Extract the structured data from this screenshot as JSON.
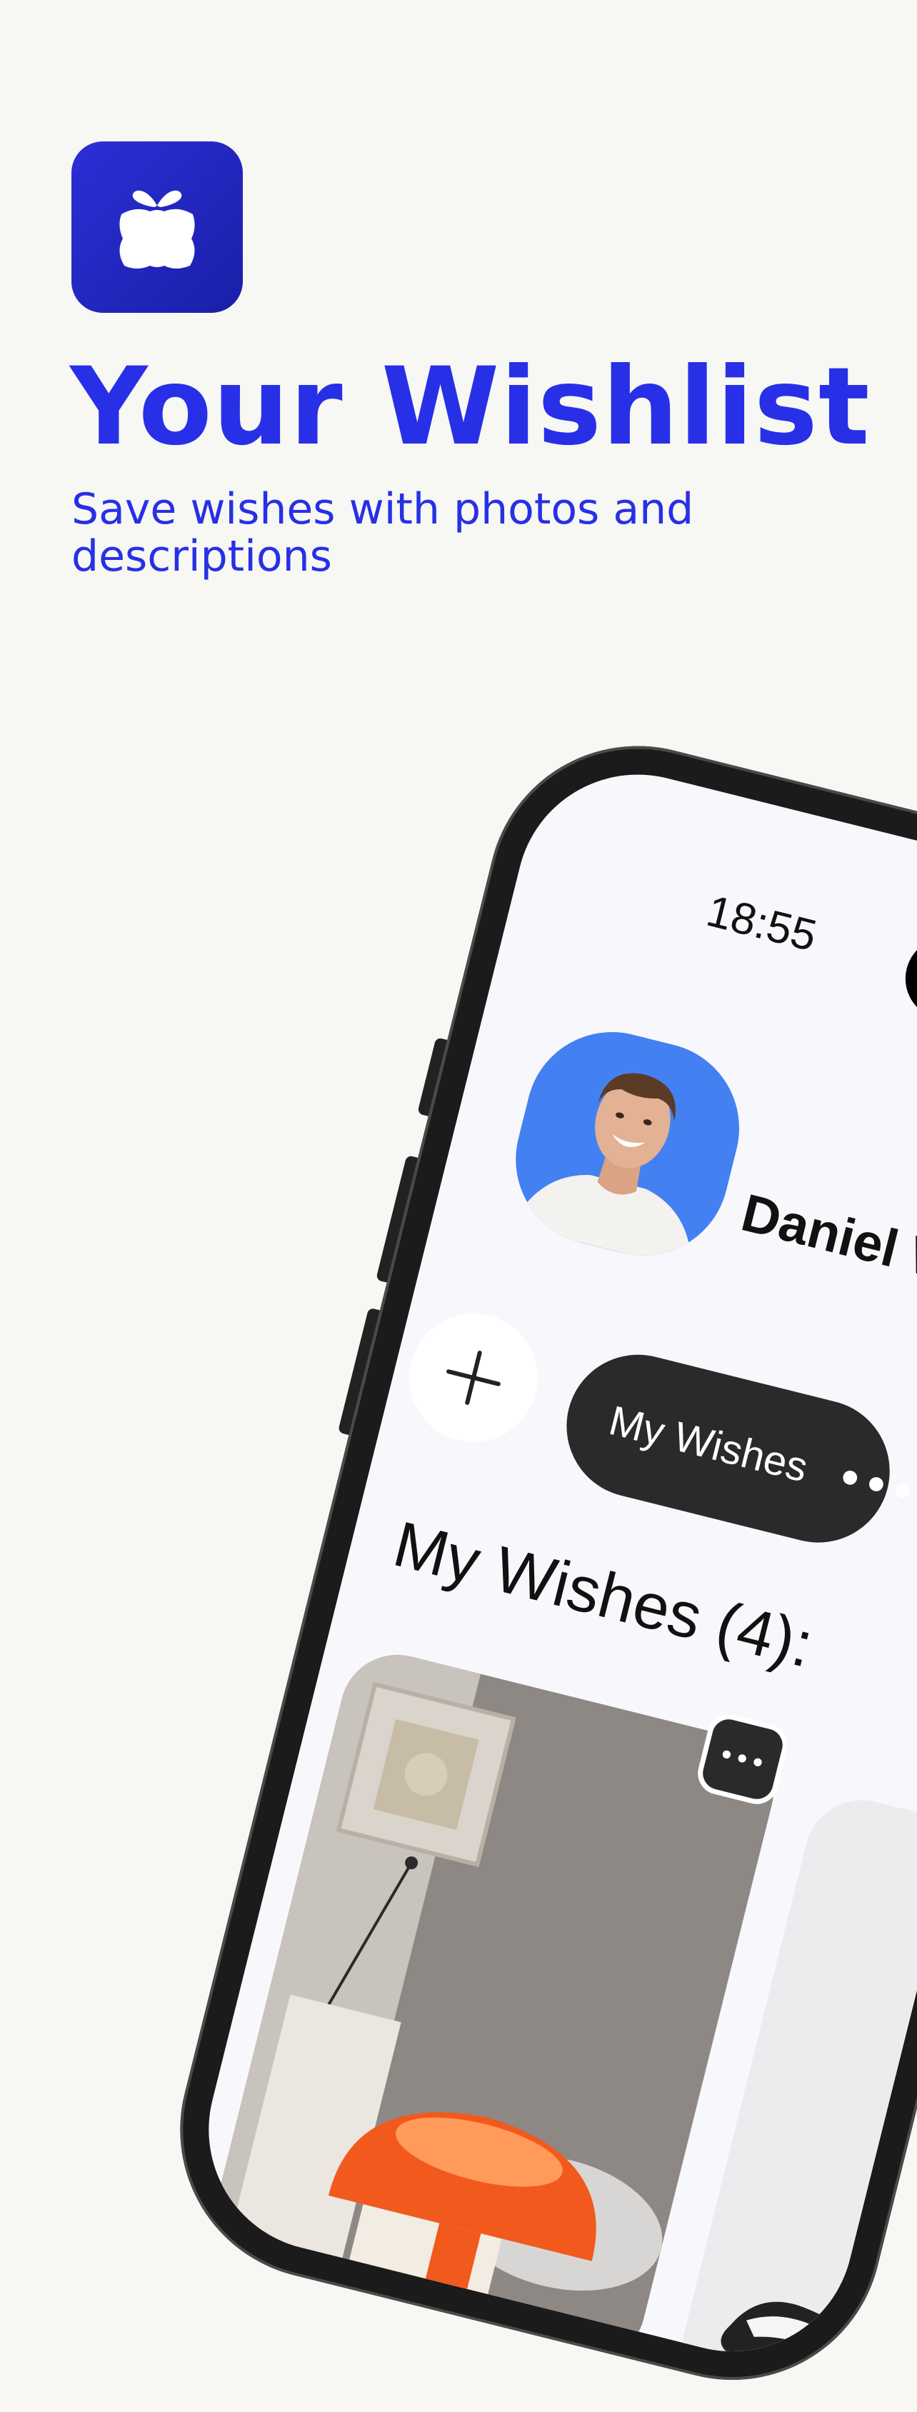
{
  "promo": {
    "title": "Your Wishlist",
    "subtitle": "Save wishes with photos and descriptions",
    "app_icon": "gift-icon"
  },
  "status_bar": {
    "time": "18:55"
  },
  "profile": {
    "name": "Daniel We"
  },
  "tabs": {
    "add_icon": "plus-icon",
    "active_label": "My Wishes",
    "menu_icon": "more-dots-icon",
    "menu_glyph": "•••"
  },
  "section": {
    "title": "My Wishes (4):"
  },
  "card": {
    "menu_icon": "more-dots-icon",
    "menu_glyph": "•••"
  },
  "colors": {
    "brand": "#2730e6",
    "icon_bg": "#1e22b8",
    "avatar_bg": "#4381f2",
    "pill_bg": "#2a2a2a",
    "background": "#f7f7f3",
    "lamp": "#f15a1c"
  }
}
